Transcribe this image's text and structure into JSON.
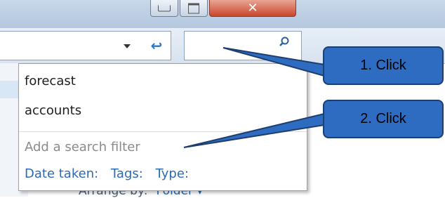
{
  "window": {
    "close_glyph": "✕"
  },
  "toolbar": {
    "refresh_glyph": "↩"
  },
  "dropdown": {
    "suggestions": [
      "forecast",
      "accounts"
    ],
    "filter_hint": "Add a search filter",
    "filters": [
      "Date taken:",
      "Tags:",
      "Type:"
    ]
  },
  "background": {
    "arrange_label": "Arrange by:",
    "arrange_value": "Folder ▾"
  },
  "callouts": [
    {
      "label": "1. Click"
    },
    {
      "label": "2. Click"
    }
  ],
  "colors": {
    "callout_fill": "#2e6cc2",
    "callout_border": "#1e3e6e",
    "link": "#2b6bb5"
  }
}
